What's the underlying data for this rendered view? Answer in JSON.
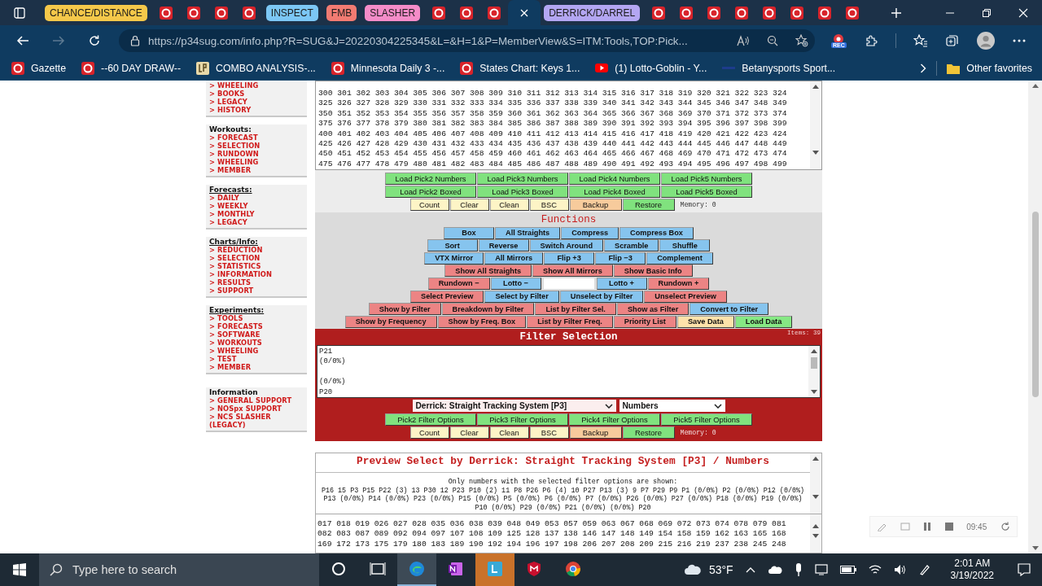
{
  "browser": {
    "tabs": [
      {
        "kind": "group",
        "label": "CHANCE/DISTANCE",
        "color": "#f5c84a"
      },
      {
        "kind": "tab",
        "selected": false
      },
      {
        "kind": "tab",
        "selected": false
      },
      {
        "kind": "tab",
        "selected": false
      },
      {
        "kind": "tab",
        "selected": false
      },
      {
        "kind": "group",
        "label": "INSPECT",
        "color": "#7cc7f5"
      },
      {
        "kind": "group",
        "label": "FMB",
        "color": "#f27b72"
      },
      {
        "kind": "group",
        "label": "SLASHER",
        "color": "#f48cc8"
      },
      {
        "kind": "tab",
        "selected": false
      },
      {
        "kind": "tab",
        "selected": false
      },
      {
        "kind": "tab",
        "selected": false
      },
      {
        "kind": "tab",
        "selected": true
      },
      {
        "kind": "group",
        "label": "DERRICK/DARREL",
        "color": "#b3a6f2"
      },
      {
        "kind": "tab",
        "selected": false
      },
      {
        "kind": "tab",
        "selected": false
      },
      {
        "kind": "tab",
        "selected": false
      },
      {
        "kind": "tab",
        "selected": false
      },
      {
        "kind": "tab",
        "selected": false
      },
      {
        "kind": "tab",
        "selected": false
      },
      {
        "kind": "tab",
        "selected": false
      },
      {
        "kind": "tab",
        "selected": false
      }
    ],
    "nav_buttons": [
      {
        "kind": "back",
        "disabled": false
      },
      {
        "kind": "forward",
        "disabled": true
      },
      {
        "kind": "refresh",
        "disabled": false
      }
    ],
    "url": "https://p34sug.com/info.php?R=SUG&J=20220304225345&L=&H=1&P=MemberView&S=ITM:Tools,TOP:Pick...",
    "extension_badge": "REC",
    "bookmarks": [
      {
        "kind": "site",
        "label": "Gazette"
      },
      {
        "kind": "site",
        "label": "--60 DAY DRAW--"
      },
      {
        "kind": "lp",
        "label": "COMBO ANALYSIS-..."
      },
      {
        "kind": "site",
        "label": "Minnesota Daily 3 -..."
      },
      {
        "kind": "site",
        "label": "States Chart: Keys 1..."
      },
      {
        "kind": "video",
        "label": "(1) Lotto-Goblin - Y..."
      },
      {
        "kind": "bar",
        "label": "Betanysports Sport..."
      }
    ],
    "other_favorites": "Other favorites"
  },
  "sidebar": [
    {
      "items": [
        "> WHEELING",
        "> BOOKS",
        "> LEGACY",
        "> HISTORY"
      ]
    },
    {
      "heading": "Workouts:",
      "underlined": false,
      "items": [
        "> FORECAST",
        "> SELECTION",
        "> RUNDOWN",
        "> WHEELING",
        "> MEMBER"
      ]
    },
    {
      "heading": "Forecasts:",
      "underlined": true,
      "items": [
        "> DAILY",
        "> WEEKLY",
        "> MONTHLY",
        "> LEGACY"
      ]
    },
    {
      "heading": "Charts/Info:",
      "underlined": true,
      "items": [
        "> REDUCTION",
        "> SELECTION",
        "> STATISTICS",
        "> INFORMATION",
        "> RESULTS",
        "> SUPPORT"
      ]
    },
    {
      "heading": "Experiments:",
      "underlined": true,
      "items": [
        "> TOOLS",
        "> FORECASTS",
        "> SOFTWARE",
        "> WORKOUTS",
        "> WHEELING",
        "> TEST",
        "> MEMBER"
      ]
    },
    {
      "heading": "Information",
      "underlined": false,
      "items": [
        "> GENERAL SUPPORT",
        "> NOSpx SUPPORT",
        "> NCS SLASHER (LEGACY)"
      ]
    }
  ],
  "number_grid": [
    "300 301 302 303 304 305 306 307 308 309 310 311 312 313 314 315 316 317 318 319 320 321 322 323 324",
    "325 326 327 328 329 330 331 332 333 334 335 336 337 338 339 340 341 342 343 344 345 346 347 348 349",
    "350 351 352 353 354 355 356 357 358 359 360 361 362 363 364 365 366 367 368 369 370 371 372 373 374",
    "375 376 377 378 379 380 381 382 383 384 385 386 387 388 389 390 391 392 393 394 395 396 397 398 399",
    "400 401 402 403 404 405 406 407 408 409 410 411 412 413 414 415 416 417 418 419 420 421 422 423 424",
    "425 426 427 428 429 430 431 432 433 434 435 436 437 438 439 440 441 442 443 444 445 446 447 448 449",
    "450 451 452 453 454 455 456 457 458 459 460 461 462 463 464 465 466 467 468 469 470 471 472 473 474",
    "475 476 477 478 479 480 481 482 483 484 485 486 487 488 489 490 491 492 493 494 495 496 497 498 499"
  ],
  "load_rows": [
    [
      {
        "label": "Load Pick2 Numbers",
        "color": "#80e27e"
      },
      {
        "label": "Load Pick3 Numbers",
        "color": "#80e27e"
      },
      {
        "label": "Load Pick4 Numbers",
        "color": "#80e27e"
      },
      {
        "label": "Load Pick5 Numbers",
        "color": "#80e27e"
      }
    ],
    [
      {
        "label": "Load Pick2 Boxed",
        "color": "#80e27e"
      },
      {
        "label": "Load Pick3 Boxed",
        "color": "#80e27e"
      },
      {
        "label": "Load Pick4 Boxed",
        "color": "#80e27e"
      },
      {
        "label": "Load Pick5 Boxed",
        "color": "#80e27e"
      }
    ]
  ],
  "util_buttons": [
    {
      "label": "Count",
      "color": "#fdf4c6"
    },
    {
      "label": "Clear",
      "color": "#fdf4c6"
    },
    {
      "label": "Clean",
      "color": "#fdf4c6"
    },
    {
      "label": "BSC",
      "color": "#fdf4c6"
    },
    {
      "label": "Backup",
      "color": "#f7cb9c"
    },
    {
      "label": "Restore",
      "color": "#80e27e"
    }
  ],
  "memory": "Memory: 0",
  "functions": {
    "title": "Functions",
    "rows": [
      [
        {
          "kind": "button",
          "label": "Box",
          "color": "#86c4ee"
        },
        {
          "kind": "button",
          "label": "All Straights",
          "color": "#86c4ee"
        },
        {
          "kind": "button",
          "label": "Compress",
          "color": "#86c4ee"
        },
        {
          "kind": "button",
          "label": "Compress Box",
          "color": "#86c4ee"
        }
      ],
      [
        {
          "kind": "button",
          "label": "Sort",
          "color": "#86c4ee"
        },
        {
          "kind": "button",
          "label": "Reverse",
          "color": "#86c4ee"
        },
        {
          "kind": "button",
          "label": "Switch Around",
          "color": "#86c4ee"
        },
        {
          "kind": "button",
          "label": "Scramble",
          "color": "#86c4ee"
        },
        {
          "kind": "button",
          "label": "Shuffle",
          "color": "#86c4ee"
        }
      ],
      [
        {
          "kind": "button",
          "label": "VTX Mirror",
          "color": "#86c4ee"
        },
        {
          "kind": "button",
          "label": "All Mirrors",
          "color": "#86c4ee"
        },
        {
          "kind": "button",
          "label": "Flip +3",
          "color": "#86c4ee"
        },
        {
          "kind": "button",
          "label": "Flip −3",
          "color": "#86c4ee"
        },
        {
          "kind": "button",
          "label": "Complement",
          "color": "#86c4ee"
        }
      ],
      [
        {
          "kind": "button",
          "label": "Show All Straights",
          "color": "#ec8484"
        },
        {
          "kind": "button",
          "label": "Show All Mirrors",
          "color": "#ec8484"
        },
        {
          "kind": "button",
          "label": "Show Basic Info",
          "color": "#ec8484"
        }
      ],
      [
        {
          "kind": "button",
          "label": "Rundown −",
          "color": "#ec8484"
        },
        {
          "kind": "button",
          "label": "Lotto −",
          "color": "#86c4ee"
        },
        {
          "kind": "field"
        },
        {
          "kind": "button",
          "label": "Lotto +",
          "color": "#86c4ee"
        },
        {
          "kind": "button",
          "label": "Rundown +",
          "color": "#ec8484"
        }
      ],
      [
        {
          "kind": "button",
          "label": "Select Preview",
          "color": "#ec8484"
        },
        {
          "kind": "button",
          "label": "Select by Filter",
          "color": "#86c4ee"
        },
        {
          "kind": "button",
          "label": "Unselect by Filter",
          "color": "#86c4ee"
        },
        {
          "kind": "button",
          "label": "Unselect Preview",
          "color": "#ec8484"
        }
      ],
      [
        {
          "kind": "button",
          "label": "Show by Filter",
          "color": "#ec8484"
        },
        {
          "kind": "button",
          "label": "Breakdown by Filter",
          "color": "#ec8484"
        },
        {
          "kind": "button",
          "label": "List by Filter Sel.",
          "color": "#ec8484"
        },
        {
          "kind": "button",
          "label": "Show as Filter",
          "color": "#ec8484"
        },
        {
          "kind": "button",
          "label": "Convert to Filter",
          "color": "#86c4ee"
        }
      ],
      [
        {
          "kind": "button",
          "label": "Show by Frequency",
          "color": "#ec8484"
        },
        {
          "kind": "button",
          "label": "Show by Freq. Box",
          "color": "#ec8484"
        },
        {
          "kind": "button",
          "label": "List by Filter Freq.",
          "color": "#ec8484"
        },
        {
          "kind": "button",
          "label": "Priority List",
          "color": "#ec8484"
        },
        {
          "kind": "button",
          "label": "Save Data",
          "color": "#fde2aa"
        },
        {
          "kind": "button",
          "label": "Load Data",
          "color": "#86e884"
        }
      ]
    ]
  },
  "filter": {
    "title": "Filter Selection",
    "items": "Items: 39",
    "text": "P21\n(0/0%)\n\n(0/0%)\nP20",
    "system_select": "Derrick: Straight Tracking System [P3]",
    "mode_select": "Numbers",
    "option_buttons": [
      {
        "label": "Pick2 Filter Options",
        "color": "#80e27e"
      },
      {
        "label": "Pick3 Filter Options",
        "color": "#80e27e"
      },
      {
        "label": "Pick4 Filter Options",
        "color": "#80e27e"
      },
      {
        "label": "Pick5 Filter Options",
        "color": "#80e27e"
      }
    ],
    "util_buttons": [
      {
        "label": "Count",
        "color": "#fdf4c6"
      },
      {
        "label": "Clear",
        "color": "#fdf4c6"
      },
      {
        "label": "Clean",
        "color": "#fdf4c6"
      },
      {
        "label": "BSC",
        "color": "#fdf4c6"
      },
      {
        "label": "Backup",
        "color": "#f7cb9c"
      },
      {
        "label": "Restore",
        "color": "#80e27e"
      }
    ],
    "memory": "Memory: 0"
  },
  "preview": {
    "title": "Preview Select by Derrick: Straight Tracking System [P3] / Numbers",
    "note": "Only numbers with the selected filter options are shown:",
    "summary": "P16 15 P3 P15 P22 (3) 13 P30 12 P23 P10 (2) 11 P8 P26 P6 (4) 10 P27 P13 (3) 9 P7 P29 P9 P1 (0/0%) P2 (0/0%) P12 (0/0%) P13 (0/0%) P14 (0/0%) P23 (0/0%) P15 (0/0%) P5 (0/0%) P6 (0/0%) P7 (0/0%) P26 (0/0%) P27 (0/0%) P18 (0/0%) P19 (0/0%) P10 (0/0%) P29 (0/0%) P21 (0/0%) (0/0%) P20",
    "numbers": [
      "017 018 019 026 027 028 035 036 038 039 048 049 053 057 059 063 067 068 069 072 073 074 078 079 081",
      "082 083 087 089 092 094 097 107 108 109 125 128 137 138 146 147 148 149 154 158 159 162 163 165 168",
      "169 172 173 175 179 180 183 189 190 192 194 196 197 198 206 207 208 209 215 216 219 237 238 245 248"
    ]
  },
  "recorder": {
    "time": "09:45"
  },
  "taskbar": {
    "search_placeholder": "Type here to search",
    "apps": [
      {
        "kind": "cortana",
        "selected": false,
        "flashing": false
      },
      {
        "kind": "taskview",
        "selected": false,
        "flashing": false
      },
      {
        "kind": "edge",
        "selected": true,
        "flashing": false
      },
      {
        "kind": "onenote",
        "selected": false,
        "flashing": false
      },
      {
        "kind": "lapp",
        "selected": false,
        "flashing": true
      },
      {
        "kind": "shield",
        "selected": false,
        "flashing": false
      },
      {
        "kind": "chrome",
        "selected": false,
        "flashing": false
      }
    ],
    "temperature": "53°F",
    "time": "2:01 AM",
    "date": "3/19/2022"
  }
}
